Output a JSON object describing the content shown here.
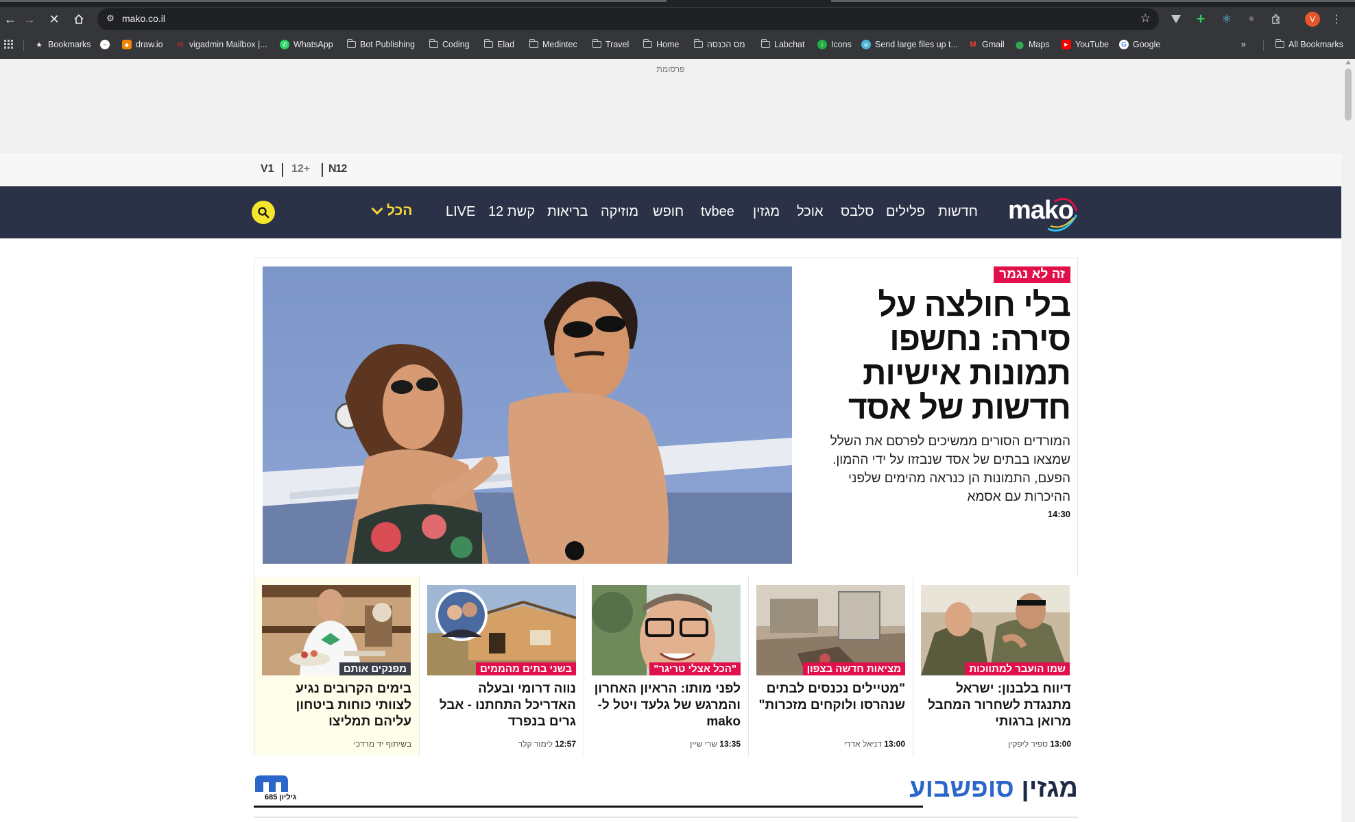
{
  "browser": {
    "url": "mako.co.il",
    "bookmarks": [
      {
        "label": "Bookmarks",
        "icon": "star-icon"
      },
      {
        "label": "",
        "icon": "messenger-icon"
      },
      {
        "label": "draw.io",
        "icon": "drawio-icon"
      },
      {
        "label": "vigadmin Mailbox |...",
        "icon": "mailbox-icon"
      },
      {
        "label": "WhatsApp",
        "icon": "whatsapp-icon"
      },
      {
        "label": "Bot Publishing",
        "icon": "folder-icon"
      },
      {
        "label": "Coding",
        "icon": "folder-icon"
      },
      {
        "label": "Elad",
        "icon": "folder-icon"
      },
      {
        "label": "Medintec",
        "icon": "folder-icon"
      },
      {
        "label": "Travel",
        "icon": "folder-icon"
      },
      {
        "label": "Home",
        "icon": "folder-icon"
      },
      {
        "label": "מס הכנסה",
        "icon": "folder-icon"
      },
      {
        "label": "Labchat",
        "icon": "folder-icon"
      },
      {
        "label": "Icons",
        "icon": "icons8-icon"
      },
      {
        "label": "Send large files up t...",
        "icon": "wetransfer-icon"
      },
      {
        "label": "Gmail",
        "icon": "gmail-icon"
      },
      {
        "label": "Maps",
        "icon": "maps-icon"
      },
      {
        "label": "YouTube",
        "icon": "youtube-icon"
      },
      {
        "label": "Google",
        "icon": "google-icon"
      }
    ],
    "all_bookmarks": "All Bookmarks",
    "overflow": "»",
    "profile_initial": "V"
  },
  "ad": {
    "label": "פרסומת"
  },
  "networks": [
    "N12",
    "12+",
    "V1"
  ],
  "nav": {
    "logo": "mako",
    "items": [
      "חדשות",
      "פלילים",
      "סלבס",
      "אוכל",
      "מגזין",
      "tvbee",
      "חופש",
      "מוזיקה",
      "בריאות",
      "קשת 12",
      "LIVE"
    ],
    "all_label": "הכל"
  },
  "hero": {
    "kicker": "זה לא נגמר",
    "title": "בלי חולצה על סירה: נחשפו תמונות אישיות חדשות של אסד",
    "subtitle": "המורדים הסורים ממשיכים לפרסם את השלל שמצאו בבתים של אסד שנבזזו על ידי ההמון. הפעם, התמונות הן כנראה מהימים שלפני ההיכרות עם אסמא",
    "time": "14:30"
  },
  "cards": [
    {
      "tag": "שמו הועבר למתווכות",
      "title": "דיווח בלבנון: ישראל מתנגדת לשחרור המחבל מרואן ברגותי",
      "time": "13:00",
      "author": "ספיר ליפקין",
      "sponsored": false
    },
    {
      "tag": "מציאות חדשה בצפון",
      "title": "\"מטיילים נכנסים לבתים שנהרסו ולוקחים מזכרות\"",
      "time": "13:00",
      "author": "דניאל אדרי",
      "sponsored": false
    },
    {
      "tag": "\"הכל אצלי טריגר\"",
      "title": "לפני מותו: הראיון האחרון והמרגש של גלעד ויטל ל-mako",
      "time": "13:35",
      "author": "שרי שיין",
      "sponsored": false
    },
    {
      "tag": "בשני בתים מהממים",
      "title": "נווה דרומי ובעלה האדריכל התחתנו - אבל גרים בנפרד",
      "time": "12:57",
      "author": "לימור קלר",
      "sponsored": false
    },
    {
      "tag": "מפנקים אותם",
      "title": "בימים הקרובים נגיע לצוותי כוחות ביטחון עליהם תמליצו",
      "time": "",
      "author": "בשיתוף יד מרדכי",
      "sponsored": true
    }
  ],
  "magazine": {
    "title_a": "מגזין",
    "title_b": "סופשבוע",
    "issue": "גיליון 685"
  },
  "colors": {
    "nav_bg": "#2b3146",
    "accent_red": "#e2104a",
    "search_yellow": "#f5e52d",
    "mag_blue": "#2b67c9"
  }
}
